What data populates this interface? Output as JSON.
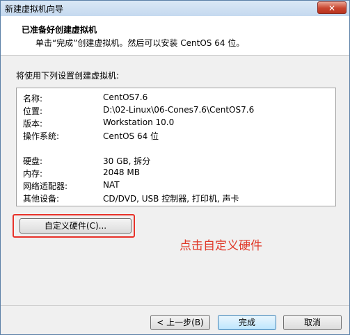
{
  "window": {
    "title": "新建虚拟机向导",
    "close_label": "✕"
  },
  "header": {
    "title": "已准备好创建虚拟机",
    "subtitle": "单击“完成”创建虚拟机。然后可以安装 CentOS 64 位。"
  },
  "intro": "将使用下列设置创建虚拟机:",
  "settings": [
    {
      "key": "名称:",
      "value": "CentOS7.6"
    },
    {
      "key": "位置:",
      "value": "D:\\02-Linux\\06-Cones7.6\\CentOS7.6"
    },
    {
      "key": "版本:",
      "value": "Workstation 10.0"
    },
    {
      "key": "操作系统:",
      "value": "CentOS 64 位"
    },
    {
      "key": "硬盘:",
      "value": "30 GB, 拆分"
    },
    {
      "key": "内存:",
      "value": "2048 MB"
    },
    {
      "key": "网络适配器:",
      "value": "NAT"
    },
    {
      "key": "其他设备:",
      "value": "CD/DVD, USB 控制器, 打印机, 声卡"
    }
  ],
  "customize_button": "自定义硬件(C)...",
  "annotation": "点击自定义硬件",
  "footer": {
    "back": "< 上一步(B)",
    "finish": "完成",
    "cancel": "取消"
  },
  "colors": {
    "highlight": "#e8322a",
    "annotation": "#e03a2a",
    "close": "#c8452f"
  }
}
